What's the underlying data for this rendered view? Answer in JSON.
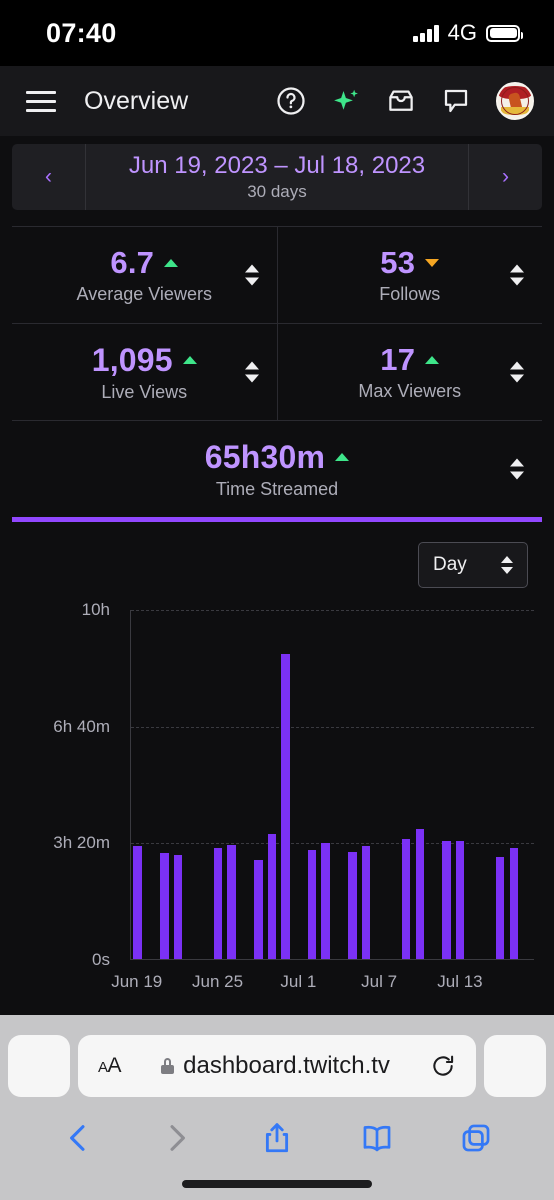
{
  "status_bar": {
    "time": "07:40",
    "network": "4G",
    "signal_icon": "cellular-signal-icon",
    "battery_icon": "battery-icon"
  },
  "app_header": {
    "menu_icon": "hamburger-menu-icon",
    "title": "Overview",
    "icons": [
      {
        "name": "help-icon",
        "label": "?"
      },
      {
        "name": "sparkle-icon",
        "label": ""
      },
      {
        "name": "inbox-icon",
        "label": ""
      },
      {
        "name": "chat-icon",
        "label": ""
      }
    ],
    "avatar_alt": "channel-avatar"
  },
  "date_picker": {
    "prev_label": "‹",
    "next_label": "›",
    "range": "Jun 19, 2023 – Jul 18, 2023",
    "duration": "30 days"
  },
  "stats": [
    {
      "value": "6.7",
      "label": "Average Viewers",
      "trend": "up",
      "trend_color": "#3ee58a"
    },
    {
      "value": "53",
      "label": "Follows",
      "trend": "down",
      "trend_color": "#f5a623"
    },
    {
      "value": "1,095",
      "label": "Live Views",
      "trend": "up",
      "trend_color": "#3ee58a"
    },
    {
      "value": "17",
      "label": "Max Viewers",
      "trend": "up",
      "trend_color": "#3ee58a"
    },
    {
      "value": "65h30m",
      "label": "Time Streamed",
      "trend": "up",
      "trend_color": "#3ee58a"
    }
  ],
  "chart_controls": {
    "granularity": "Day"
  },
  "chart_data": {
    "type": "bar",
    "title": "",
    "xlabel": "",
    "ylabel": "",
    "grid": true,
    "legend": "none",
    "bar_color": "#7b31f5",
    "ylim": [
      0,
      36000
    ],
    "y_ticks": [
      {
        "label": "10h",
        "value": 36000
      },
      {
        "label": "6h 40m",
        "value": 24000
      },
      {
        "label": "3h 20m",
        "value": 12000
      },
      {
        "label": "0s",
        "value": 0
      }
    ],
    "x_ticks": [
      {
        "label": "Jun 19",
        "index": 0
      },
      {
        "label": "Jun 25",
        "index": 6
      },
      {
        "label": "Jul 1",
        "index": 12
      },
      {
        "label": "Jul 7",
        "index": 18
      },
      {
        "label": "Jul 13",
        "index": 24
      }
    ],
    "categories": [
      "Jun 19",
      "Jun 20",
      "Jun 21",
      "Jun 22",
      "Jun 23",
      "Jun 24",
      "Jun 25",
      "Jun 26",
      "Jun 27",
      "Jun 28",
      "Jun 29",
      "Jun 30",
      "Jul 1",
      "Jul 2",
      "Jul 3",
      "Jul 4",
      "Jul 5",
      "Jul 6",
      "Jul 7",
      "Jul 8",
      "Jul 9",
      "Jul 10",
      "Jul 11",
      "Jul 12",
      "Jul 13",
      "Jul 14",
      "Jul 15",
      "Jul 16",
      "Jul 17",
      "Jul 18"
    ],
    "values_hours": [
      3.25,
      0,
      3.05,
      3.0,
      0,
      0,
      3.2,
      3.3,
      0,
      2.85,
      3.6,
      8.75,
      0,
      3.15,
      3.35,
      0,
      3.1,
      3.25,
      0,
      0,
      3.45,
      3.75,
      0,
      3.4,
      3.4,
      0,
      0,
      2.95,
      3.2,
      0
    ],
    "values_labels": [
      "3h 15m",
      "0s",
      "3h 3m",
      "3h 0m",
      "0s",
      "0s",
      "3h 12m",
      "3h 18m",
      "0s",
      "2h 51m",
      "3h 36m",
      "8h 45m",
      "0s",
      "3h 9m",
      "3h 21m",
      "0s",
      "3h 6m",
      "3h 15m",
      "0s",
      "0s",
      "3h 27m",
      "3h 45m",
      "0s",
      "3h 24m",
      "3h 24m",
      "0s",
      "0s",
      "2h 57m",
      "3h 12m",
      "0s"
    ]
  },
  "browser": {
    "text_size_label": "AA",
    "lock_icon": "lock-icon",
    "url": "dashboard.twitch.tv",
    "reload_icon": "reload-icon",
    "toolbar": [
      {
        "name": "back-button",
        "enabled": true
      },
      {
        "name": "forward-button",
        "enabled": false
      },
      {
        "name": "share-button",
        "enabled": true
      },
      {
        "name": "bookmarks-button",
        "enabled": true
      },
      {
        "name": "tabs-button",
        "enabled": true
      }
    ]
  }
}
